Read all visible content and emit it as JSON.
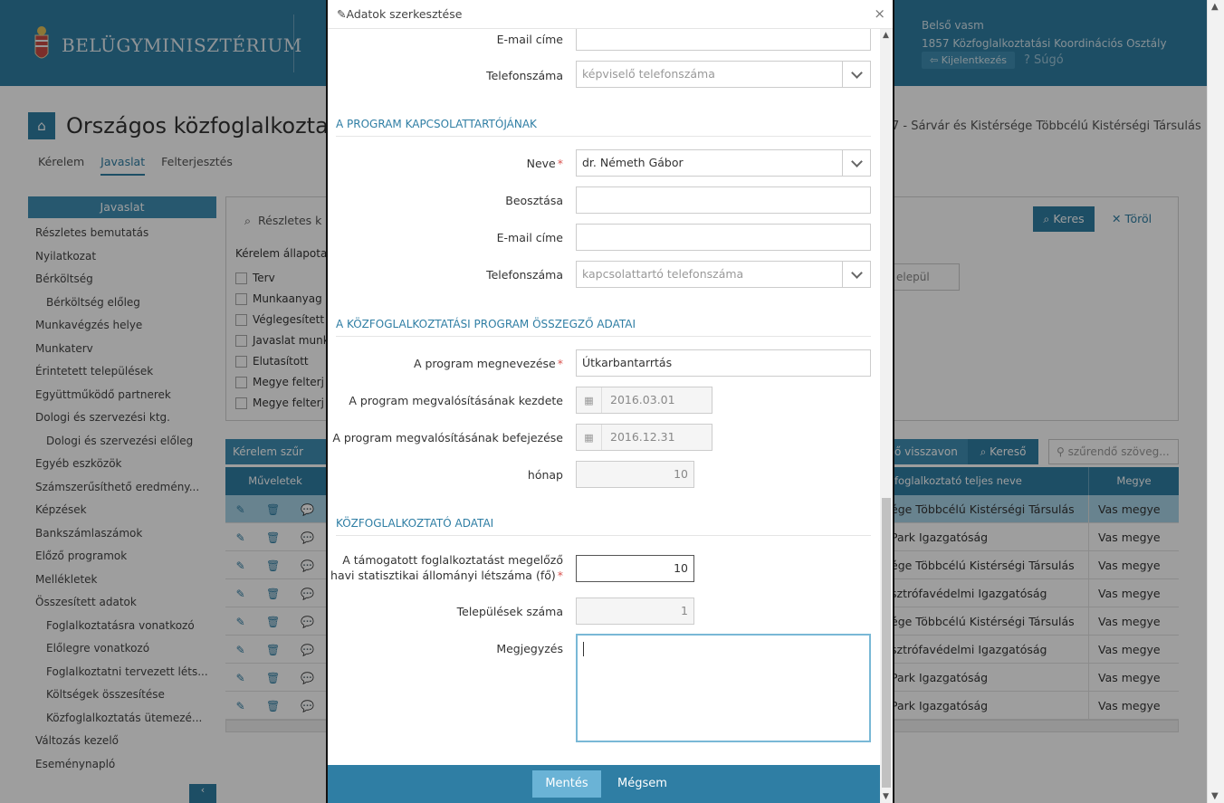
{
  "header": {
    "ministry": "BELÜGYMINISZTÉRIUM",
    "user_name": "Belső vasm",
    "user_org": "1857 Közfoglalkoztatási Koordinációs Osztály",
    "logout_label": "Kijelentkezés",
    "help_label": "? Súgó"
  },
  "page": {
    "title": "Országos közfoglalkoztat",
    "org_right": "7 - Sárvár és Kistérsége Többcélú Kistérségi Társulás",
    "tabs": [
      "Kérelem",
      "Javaslat",
      "Felterjesztés"
    ],
    "active_tab": "Javaslat"
  },
  "sidebar": {
    "title": "Javaslat",
    "items": [
      {
        "label": "Részletes bemutatás",
        "sub": false
      },
      {
        "label": "Nyilatkozat",
        "sub": false
      },
      {
        "label": "Bérköltség",
        "sub": false
      },
      {
        "label": "Bérköltség előleg",
        "sub": true
      },
      {
        "label": "Munkavégzés helye",
        "sub": false
      },
      {
        "label": "Munkaterv",
        "sub": false
      },
      {
        "label": "Érintetett települések",
        "sub": false
      },
      {
        "label": "Együttműködő partnerek",
        "sub": false
      },
      {
        "label": "Dologi és szervezési ktg.",
        "sub": false
      },
      {
        "label": "Dologi és szervezési előleg",
        "sub": true
      },
      {
        "label": "Egyéb eszközök",
        "sub": false
      },
      {
        "label": "Számszerűsíthető eredmény...",
        "sub": false
      },
      {
        "label": "Képzések",
        "sub": false
      },
      {
        "label": "Bankszámlaszámok",
        "sub": false
      },
      {
        "label": "Előző programok",
        "sub": false
      },
      {
        "label": "Mellékletek",
        "sub": false
      },
      {
        "label": "Összesített adatok",
        "sub": false
      },
      {
        "label": "Foglalkoztatásra vonatkozó",
        "sub": true
      },
      {
        "label": "Előlegre vonatkozó",
        "sub": true
      },
      {
        "label": "Foglalkoztatni tervezett léts...",
        "sub": true
      },
      {
        "label": "Költségek összesítése",
        "sub": true
      },
      {
        "label": "Közfoglalkoztatás ütemezé...",
        "sub": true
      },
      {
        "label": "Változás kezelő",
        "sub": false
      },
      {
        "label": "Eseménynapló",
        "sub": false
      }
    ]
  },
  "search": {
    "title": "Részletes k",
    "state_label": "Kérelem állapota",
    "states": [
      "Terv",
      "Munkaanyag",
      "Véglegesített",
      "Javaslat munk",
      "Elutasított",
      "Megye felterj",
      "Megye felterj"
    ],
    "search_btn": "Keres",
    "clear_btn": "Töröl",
    "settlement": "elepül"
  },
  "grid": {
    "tool1": "Kérelem szűr",
    "tool2": "ő visszavon",
    "tool3": "Kereső",
    "filter_placeholder": "szűrendő szöveg...",
    "col_actions": "Műveletek",
    "col_name": "foglalkoztató teljes neve",
    "col_county": "Megye",
    "rows": [
      {
        "name": "ége Többcélú Kistérségi Társulás",
        "county": "Vas megye",
        "selected": true
      },
      {
        "name": "Park Igazgatóság",
        "county": "Vas megye",
        "selected": false
      },
      {
        "name": "ége Többcélú Kistérségi Társulás",
        "county": "Vas megye",
        "selected": false
      },
      {
        "name": "sztrófavédelmi Igazgatóság",
        "county": "Vas megye",
        "selected": false
      },
      {
        "name": "ége Többcélú Kistérségi Társulás",
        "county": "Vas megye",
        "selected": false
      },
      {
        "name": "sztrófavédelmi Igazgatóság",
        "county": "Vas megye",
        "selected": false
      },
      {
        "name": "Park Igazgatóság",
        "county": "Vas megye",
        "selected": false
      },
      {
        "name": "Park Igazgatóság",
        "county": "Vas megye",
        "selected": false
      }
    ]
  },
  "modal": {
    "title": "Adatok szerkesztése",
    "close": "×",
    "rep_email_label": "E-mail címe",
    "rep_email_value": "",
    "rep_phone_label": "Telefonszáma",
    "rep_phone_placeholder": "képviselő telefonszáma",
    "section_contact": "A PROGRAM KAPCSOLATTARTÓJÁNAK",
    "contact_name_label": "Neve",
    "contact_name_value": "dr. Németh Gábor",
    "contact_position_label": "Beosztása",
    "contact_position_value": "",
    "contact_email_label": "E-mail címe",
    "contact_email_value": "",
    "contact_phone_label": "Telefonszáma",
    "contact_phone_placeholder": "kapcsolattartó telefonszáma",
    "section_summary": "A KÖZFOGLALKOZTATÁSI PROGRAM ÖSSZEGZŐ ADATAI",
    "program_name_label": "A program megnevezése",
    "program_name_value": "Útkarbantarrtás",
    "start_label": "A program megvalósításának kezdete",
    "start_value": "2016.03.01",
    "end_label": "A program megvalósításának befejezése",
    "end_value": "2016.12.31",
    "months_label": "hónap",
    "months_value": "10",
    "section_employer": "KÖZFOGLALKOZTATÓ ADATAI",
    "headcount_label_1": "A támogatott foglalkoztatást megelőző",
    "headcount_label_2": "havi statisztikai állományi létszáma (fő)",
    "headcount_value": "10",
    "settlements_label": "Települések száma",
    "settlements_value": "1",
    "note_label": "Megjegyzés",
    "note_value": "",
    "save_label": "Mentés",
    "cancel_label": "Mégsem"
  },
  "colors": {
    "primary": "#2f7ea4",
    "save_button": "#6ab3d6",
    "required": "#d9534f"
  }
}
